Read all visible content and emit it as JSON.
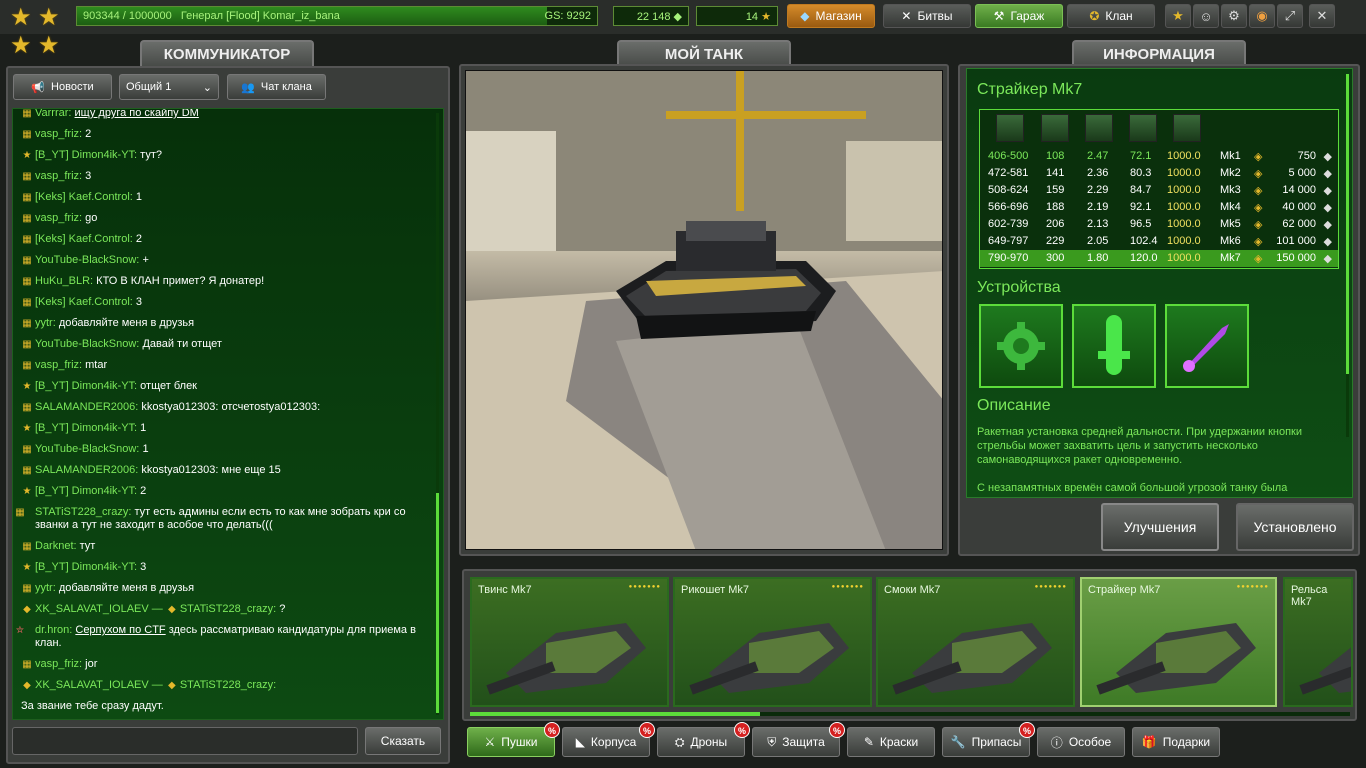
{
  "topbar": {
    "xp_text": "903344 / 1000000",
    "rank_user": "Генерал [Flood] Komar_iz_bana",
    "gs": "GS: 9292",
    "xp_fraction": 0.9033,
    "crystals": "22 148",
    "stars": "14",
    "shop": "Магазин",
    "battles": "Битвы",
    "garage": "Гараж",
    "clan": "Клан"
  },
  "tabs": {
    "communicator": "КОММУНИКАТОР",
    "my_tank": "МОЙ ТАНК",
    "info": "ИНФОРМАЦИЯ"
  },
  "chat": {
    "news_btn": "Новости",
    "channel_select": "Общий 1",
    "clan_chat_btn": "Чат клана",
    "say_btn": "Сказать",
    "messages": [
      {
        "nick": "Varrrar:",
        "text": "ищу друга по скайпу DM",
        "icon": "rank-icon"
      },
      {
        "nick": "vasp_friz:",
        "text": "2",
        "icon": "rank-icon"
      },
      {
        "nick": "[B_YT] Dimon4ik-YT:",
        "text": "тут?",
        "icon": "star-icon"
      },
      {
        "nick": "vasp_friz:",
        "text": "3",
        "icon": "rank-icon"
      },
      {
        "nick": "[Keks] Kaef.Control:",
        "text": "1",
        "icon": "rank-icon"
      },
      {
        "nick": "vasp_friz:",
        "text": "go",
        "icon": "rank-icon"
      },
      {
        "nick": "[Keks] Kaef.Control:",
        "text": "2",
        "icon": "rank-icon"
      },
      {
        "nick": "YouTube-BlackSnow:",
        "text": "+",
        "icon": "rank-icon"
      },
      {
        "nick": "HuKu_BLR:",
        "text": "КТО В КЛАН примет? Я донатер!",
        "icon": "rank-icon"
      },
      {
        "nick": "[Keks] Kaef.Control:",
        "text": "3",
        "icon": "rank-icon"
      },
      {
        "nick": "yytr:",
        "text": "добавляйте меня в друзья",
        "icon": "rank-icon"
      },
      {
        "nick": "YouTube-BlackSnow:",
        "text": "Давай ти отщет",
        "icon": "rank-icon"
      },
      {
        "nick": "vasp_friz:",
        "text": "mtar",
        "icon": "rank-icon"
      },
      {
        "nick": "[B_YT] Dimon4ik-YT:",
        "text": "отщет блек",
        "icon": "star-icon"
      },
      {
        "nick": "SALAMANDER2006:",
        "text": "kkostya012303: отсчетоstya012303:",
        "icon": "rank-icon"
      },
      {
        "nick": "[B_YT] Dimon4ik-YT:",
        "text": "1",
        "icon": "star-icon"
      },
      {
        "nick": "YouTube-BlackSnow:",
        "text": "1",
        "icon": "rank-icon"
      },
      {
        "nick": "SALAMANDER2006:",
        "text": "kkostya012303: мне еще 15",
        "icon": "rank-icon"
      },
      {
        "nick": "[B_YT] Dimon4ik-YT:",
        "text": "2",
        "icon": "star-icon"
      }
    ],
    "long_msg_1": {
      "nick": "STATiST228_crazy:",
      "text": "тут есть админы если есть то как мне зобрать кри со званки а тут не заходит в асобое что делать(((",
      "icon": "rank-icon"
    },
    "messages2": [
      {
        "nick": "Darknet:",
        "text": "тут",
        "icon": "rank-icon"
      },
      {
        "nick": "[B_YT] Dimon4ik-YT:",
        "text": "3",
        "icon": "star-icon"
      },
      {
        "nick": "yytr:",
        "text": "добавляйте меня в друзья",
        "icon": "rank-icon"
      }
    ],
    "private_msg": {
      "from": "XK_SALAVAT_IOLAEV —",
      "to": "STATiST228_crazy:",
      "text": "?"
    },
    "long_msg_2": {
      "nick": "dr.hron:",
      "link": "Серпухом по CTF",
      "text": " здесь рассматриваю кандидатуры для приема в клан."
    },
    "msg_jor": {
      "nick": "vasp_friz:",
      "text": "jor"
    },
    "private_msg2": {
      "from": "XK_SALAVAT_IOLAEV —",
      "to": "STATiST228_crazy:",
      "text": ""
    },
    "last_line": "За звание тебе сразу дадут."
  },
  "info": {
    "title": "Страйкер Mk7",
    "devices_heading": "Устройства",
    "desc_heading": "Описание",
    "desc_p1": "Ракетная установка средней дальности. При удержании кнопки стрельбы может захватить цель и запустить несколько самонаводящихся ракет одновременно.",
    "desc_p2": "С незапамятных времён самой большой угрозой танку была",
    "rows": [
      {
        "c1": "406-500",
        "c2": "108",
        "c3": "2.47",
        "c4": "72.1",
        "c5": "1000.0",
        "mk": "Mk1",
        "price": "750"
      },
      {
        "c1": "472-581",
        "c2": "141",
        "c3": "2.36",
        "c4": "80.3",
        "c5": "1000.0",
        "mk": "Mk2",
        "price": "5 000"
      },
      {
        "c1": "508-624",
        "c2": "159",
        "c3": "2.29",
        "c4": "84.7",
        "c5": "1000.0",
        "mk": "Mk3",
        "price": "14 000"
      },
      {
        "c1": "566-696",
        "c2": "188",
        "c3": "2.19",
        "c4": "92.1",
        "c5": "1000.0",
        "mk": "Mk4",
        "price": "40 000"
      },
      {
        "c1": "602-739",
        "c2": "206",
        "c3": "2.13",
        "c4": "96.5",
        "c5": "1000.0",
        "mk": "Mk5",
        "price": "62 000"
      },
      {
        "c1": "649-797",
        "c2": "229",
        "c3": "2.05",
        "c4": "102.4",
        "c5": "1000.0",
        "mk": "Mk6",
        "price": "101 000"
      },
      {
        "c1": "790-970",
        "c2": "300",
        "c3": "1.80",
        "c4": "120.0",
        "c5": "1000.0",
        "mk": "Mk7",
        "price": "150 000"
      }
    ],
    "upgrade_btn": "Улучшения",
    "installed_btn": "Установлено"
  },
  "items": [
    {
      "name": "Твинс Mk7"
    },
    {
      "name": "Рикошет Mk7"
    },
    {
      "name": "Смоки Mk7"
    },
    {
      "name": "Страйкер Mk7"
    },
    {
      "name": "Рельса Mk7"
    }
  ],
  "item_stars": "●●●●●●●",
  "categories": {
    "guns": "Пушки",
    "hulls": "Корпуса",
    "drones": "Дроны",
    "protection": "Защита",
    "paints": "Краски",
    "supplies": "Припасы",
    "special": "Особое",
    "gifts": "Подарки"
  },
  "badge": "%"
}
